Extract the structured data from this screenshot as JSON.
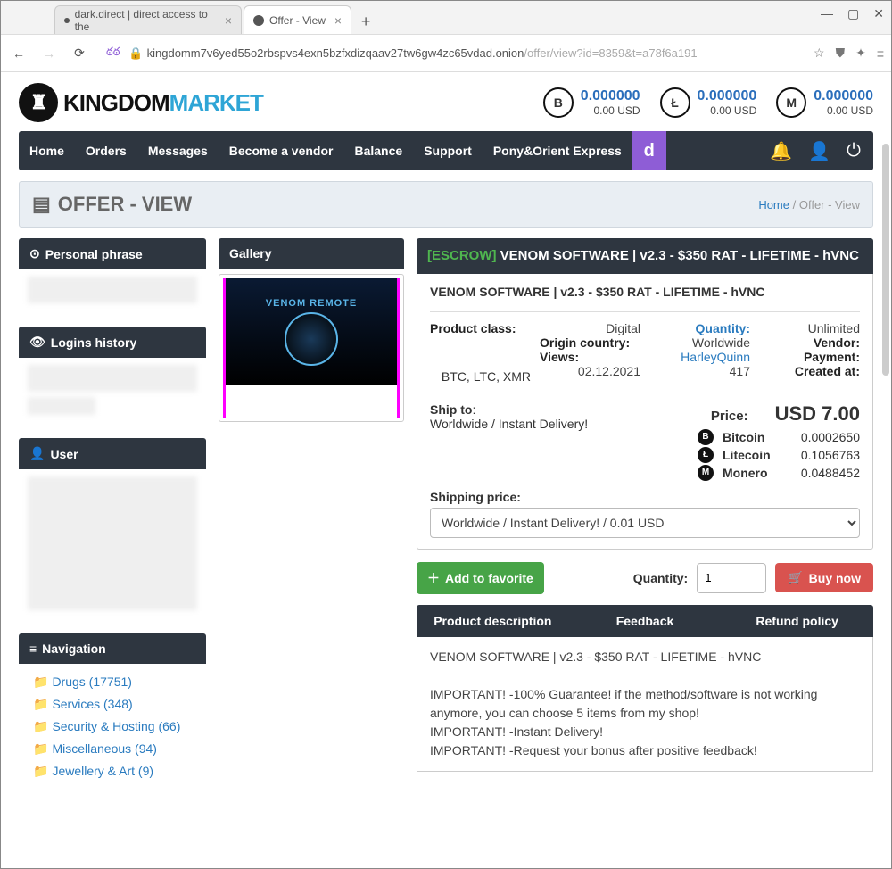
{
  "browser": {
    "tabs": [
      {
        "title": "dark.direct | direct access to the",
        "active": false
      },
      {
        "title": "Offer - View",
        "active": true
      }
    ],
    "url_host": "kingdomm7v6yed55o2rbspvs4exn5bzfxdizqaav27tw6gw4zc65vdad.onion",
    "url_path": "/offer/view?id=8359&t=a78f6a191"
  },
  "site": {
    "logo_part1": "KINGDOM",
    "logo_part2": "MARKET",
    "balances": [
      {
        "coin": "Bitcoin",
        "sym": "B",
        "amount": "0.000000",
        "usd": "0.00 USD"
      },
      {
        "coin": "Litecoin",
        "sym": "Ł",
        "amount": "0.000000",
        "usd": "0.00 USD"
      },
      {
        "coin": "Monero",
        "sym": "M",
        "amount": "0.000000",
        "usd": "0.00 USD"
      }
    ],
    "nav": [
      "Home",
      "Orders",
      "Messages",
      "Become a vendor",
      "Balance",
      "Support",
      "Pony&Orient Express"
    ]
  },
  "page_header": {
    "title": "OFFER - VIEW",
    "breadcrumb_home": "Home",
    "breadcrumb_current": "Offer - View"
  },
  "sidebars": {
    "personal_phrase": "Personal phrase",
    "logins_history": "Logins history",
    "user": "User",
    "navigation": "Navigation",
    "nav_items": [
      "Drugs (17751)",
      "Services (348)",
      "Security & Hosting (66)",
      "Miscellaneous (94)",
      "Jewellery & Art (9)"
    ]
  },
  "gallery": {
    "title": "Gallery",
    "image_text": "VENOM REMOTE"
  },
  "offer": {
    "escrow": "[ESCROW]",
    "title": "VENOM SOFTWARE | v2.3 - $350 RAT - LIFETIME - hVNC",
    "subtitle": "VENOM SOFTWARE | v2.3 - $350 RAT - LIFETIME - hVNC",
    "product_class_label": "Product class",
    "product_class_value": "Digital",
    "origin_label": "Origin country",
    "origin_value": "Worldwide",
    "views_label": "Views",
    "views_value": "417",
    "currencies": "BTC, LTC, XMR",
    "created_date": "02.12.2021",
    "quantity_label": "Quantity",
    "quantity_value": "Unlimited",
    "vendor_label": "Vendor",
    "vendor_value": "HarleyQuinn",
    "payment_label": "Payment",
    "created_label": "Created at",
    "ship_to_label": "Ship to",
    "ship_to_value": "Worldwide / Instant Delivery!",
    "price_label": "Price:",
    "price_value": "USD 7.00",
    "coins": [
      {
        "name": "Bitcoin",
        "sym": "B",
        "val": "0.0002650"
      },
      {
        "name": "Litecoin",
        "sym": "Ł",
        "val": "0.1056763"
      },
      {
        "name": "Monero",
        "sym": "M",
        "val": "0.0488452"
      }
    ],
    "shipping_price_label": "Shipping price:",
    "shipping_option": "Worldwide / Instant Delivery! / 0.01 USD",
    "fav_button": "Add to favorite",
    "qty_label": "Quantity:",
    "qty_value": "1",
    "buy_button": "Buy now",
    "tabs": [
      "Product description",
      "Feedback",
      "Refund policy"
    ],
    "description_lines": [
      "VENOM SOFTWARE | v2.3 - $350 RAT - LIFETIME - hVNC",
      "",
      "IMPORTANT! -100% Guarantee! if the method/software is not working anymore, you can choose 5 items from my shop!",
      "IMPORTANT! -Instant Delivery!",
      "IMPORTANT! -Request your bonus after positive feedback!"
    ]
  }
}
